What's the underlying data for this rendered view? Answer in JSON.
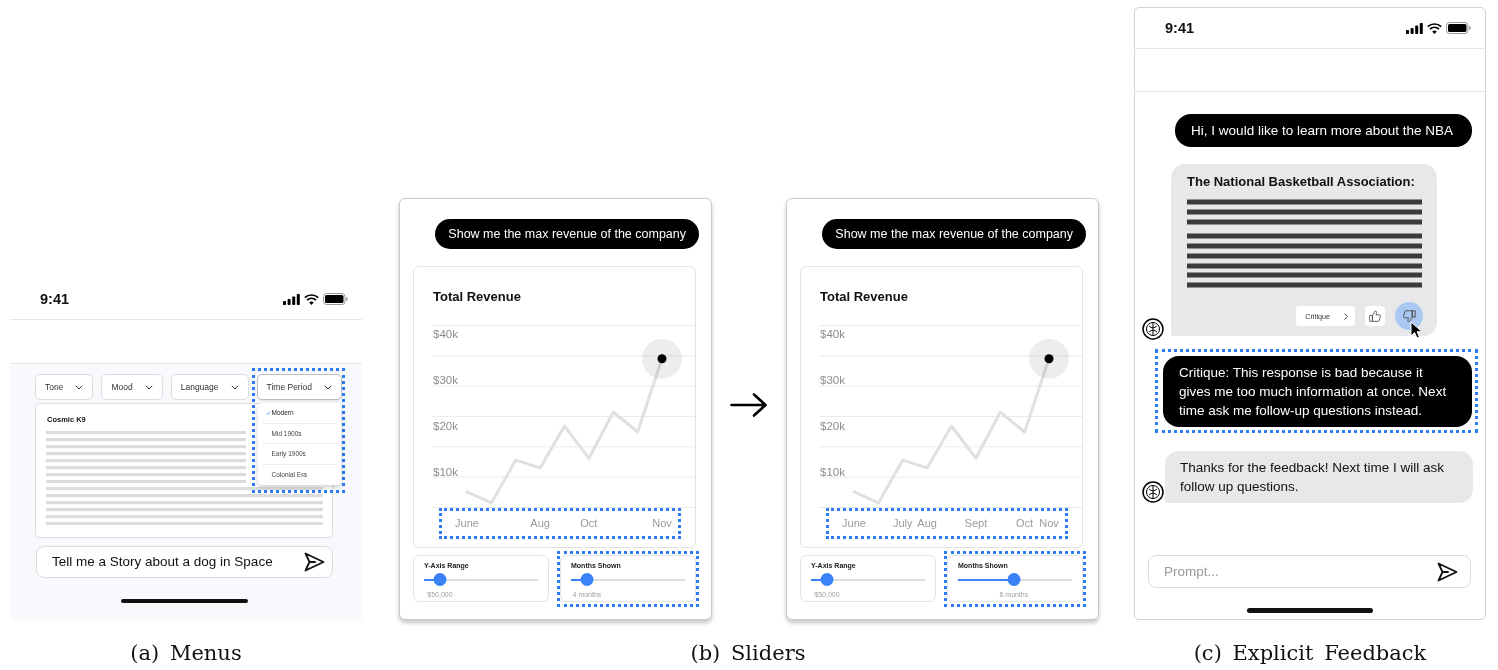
{
  "menus_panel": {
    "status_bar": {
      "time": "9:41"
    },
    "dropdowns": [
      {
        "label": "Tone",
        "expanded": false,
        "highlighted": false
      },
      {
        "label": "Mood",
        "expanded": false,
        "highlighted": false
      },
      {
        "label": "Language",
        "expanded": false,
        "highlighted": false
      },
      {
        "label": "Time Period",
        "expanded": true,
        "highlighted": true,
        "options": [
          {
            "label": "Modern",
            "selected": true
          },
          {
            "label": "Mid 1900s",
            "selected": false
          },
          {
            "label": "Early 1900s",
            "selected": false
          },
          {
            "label": "Colonial Era",
            "selected": false
          }
        ]
      }
    ],
    "story": {
      "title": "Cosmic K9"
    },
    "prompt": {
      "value": "Tell me a Story about a dog in Space"
    },
    "caption": "(a) Menus"
  },
  "sliders_panel": {
    "steps": [
      {
        "prompt": "Show me the max revenue of the company",
        "chart": {
          "chart_data": {
            "type": "line",
            "title": "Total Revenue",
            "categories": [
              "June",
              null,
              null,
              "Aug",
              null,
              "Oct",
              null,
              null,
              "Nov"
            ],
            "values": [
              5700,
              3300,
              12600,
              10900,
              20000,
              13000,
              23000,
              18700,
              34600
            ],
            "ylim": [
              -6490,
              54760
            ],
            "yticks": [
              {
                "value": 40000,
                "label": "$40k"
              },
              {
                "value": 30000,
                "label": "$30k"
              },
              {
                "value": 20000,
                "label": "$20k"
              },
              {
                "value": 10000,
                "label": "$10k"
              }
            ]
          },
          "x_axis_highlighted": true
        },
        "sliders": [
          {
            "label": "Y-Axis Range",
            "level": 0.14,
            "reading": "$50,000",
            "highlighted": false
          },
          {
            "label": "Months Shown",
            "level": 0.14,
            "reading": "4 months",
            "highlighted": true
          }
        ]
      },
      {
        "prompt": "Show me the max revenue of the company",
        "chart": {
          "chart_data": {
            "type": "line",
            "title": "Total Revenue",
            "categories": [
              "June",
              null,
              "July",
              "Aug",
              null,
              "Sept",
              null,
              "Oct",
              "Nov"
            ],
            "values": [
              5700,
              3300,
              12600,
              10900,
              20000,
              13000,
              23000,
              18700,
              34600
            ],
            "ylim": [
              -6490,
              54760
            ],
            "yticks": [
              {
                "value": 40000,
                "label": "$40k"
              },
              {
                "value": 30000,
                "label": "$30k"
              },
              {
                "value": 20000,
                "label": "$20k"
              },
              {
                "value": 10000,
                "label": "$10k"
              }
            ]
          },
          "x_axis_highlighted": true
        },
        "sliders": [
          {
            "label": "Y-Axis Range",
            "level": 0.14,
            "reading": "$50,000",
            "highlighted": false
          },
          {
            "label": "Months Shown",
            "level": 0.49,
            "reading": "6 months",
            "highlighted": true
          }
        ]
      }
    ],
    "caption": "(b) Sliders"
  },
  "feedback_panel": {
    "status_bar": {
      "time": "9:41"
    },
    "messages": [
      {
        "kind": "user",
        "text": "Hi, I would like to learn more about the NBA",
        "highlighted": false
      },
      {
        "kind": "response",
        "title": "The National Basketball Association:",
        "critique_button": "Critique",
        "feedback": [
          {
            "kind": "thumbs_up",
            "selected": false,
            "hovered": false
          },
          {
            "kind": "thumbs_down",
            "selected": true,
            "hovered": true
          }
        ],
        "highlighted": false
      },
      {
        "kind": "user",
        "text": "Critique: This response is bad because it gives me too much information at once. Next time ask me follow-up questions instead.",
        "highlighted": true
      },
      {
        "kind": "assistant",
        "text": "Thanks for the feedback! Next time I will ask follow up questions.",
        "highlighted": false
      }
    ],
    "prompt": {
      "placeholder": "Prompt..."
    },
    "caption": "(c) Explicit Feedback"
  }
}
